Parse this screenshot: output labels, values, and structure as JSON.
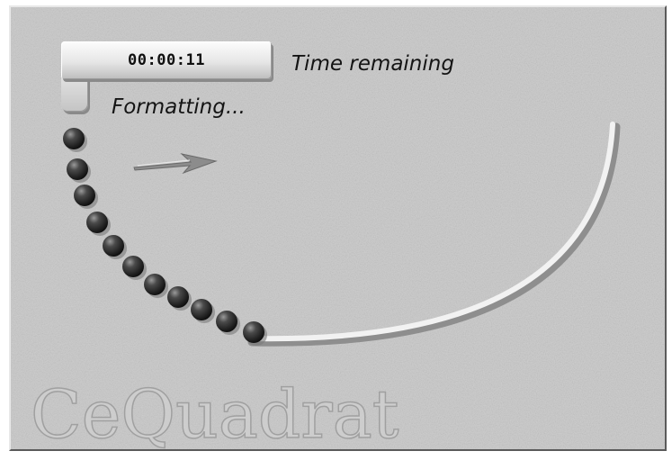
{
  "dialog": {
    "time_value": "00:00:11",
    "time_label": "Time remaining",
    "status_text": "Formatting...",
    "watermark_text": "CeQuadrat"
  },
  "progress": {
    "filled_beads": 11,
    "total_beads": 28,
    "fraction": 0.39
  },
  "icons": [
    "arrow-icon"
  ],
  "colors": {
    "background": "#c6c6c6",
    "bead": "#2e2e2e",
    "text": "#141414"
  }
}
